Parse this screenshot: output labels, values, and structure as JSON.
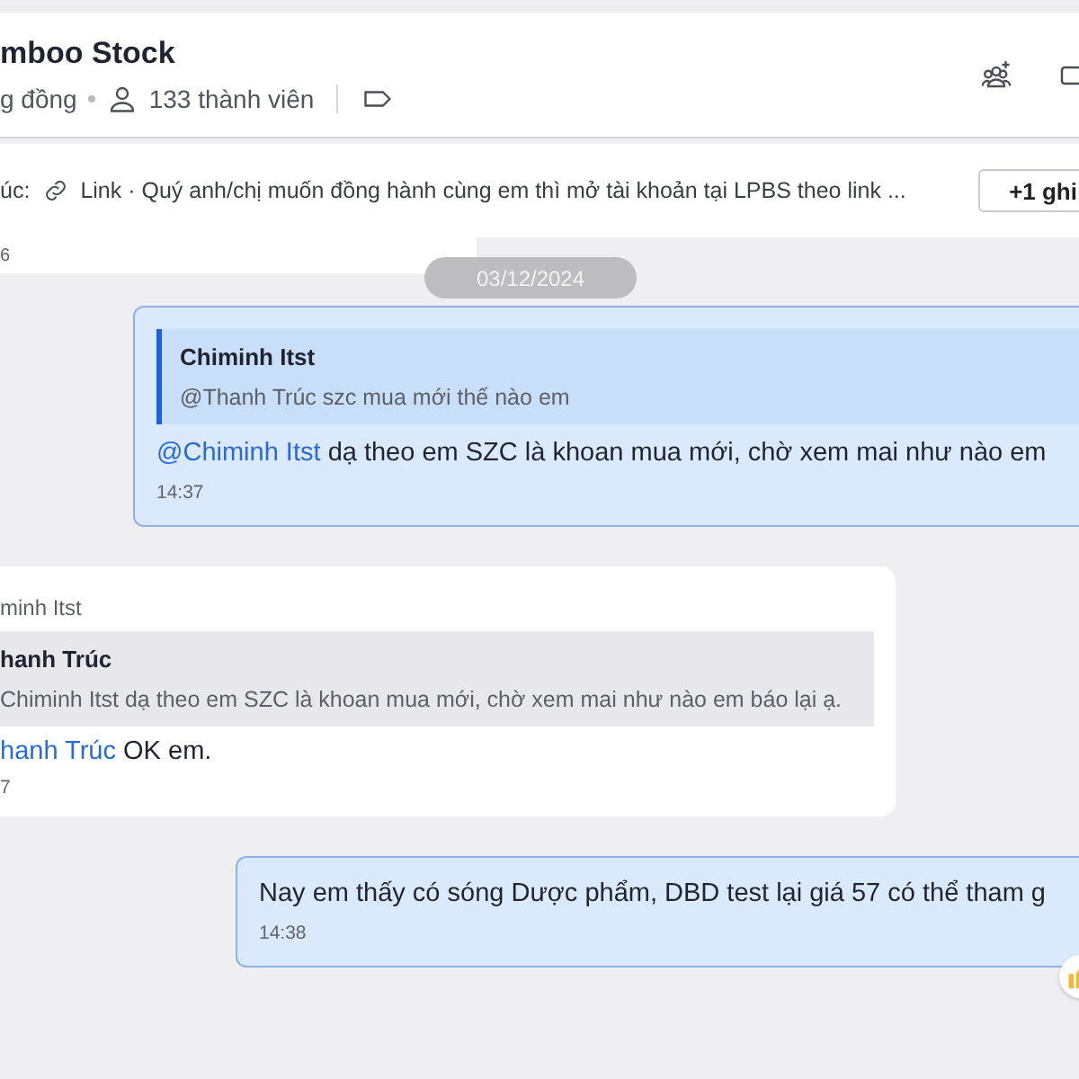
{
  "header": {
    "title": "mboo Stock",
    "community": "g đồng",
    "members": "133 thành viên"
  },
  "pinned": {
    "prefix": "úc:",
    "link_label": "Link",
    "text": "· Quý anh/chị muốn đồng hành cùng em thì mở tài khoản tại LPBS theo link ...",
    "button": "+1 ghi"
  },
  "prev_time": "6",
  "date_separator": "03/12/2024",
  "messages": [
    {
      "kind": "own",
      "quote": {
        "author": "Chiminh Itst",
        "text": "@Thanh Trúc szc mua mới thế nào em"
      },
      "mention": "@Chiminh Itst",
      "text": "dạ theo em SZC là khoan mua mới, chờ xem mai như nào em",
      "time": "14:37"
    },
    {
      "kind": "other",
      "sender": "minh Itst",
      "quote": {
        "author": "hanh Trúc",
        "text": "Chiminh Itst dạ theo em SZC là khoan mua mới, chờ xem mai như nào em báo lại ạ."
      },
      "mention": "hanh Trúc",
      "text": "OK em.",
      "time": "7"
    },
    {
      "kind": "own",
      "text": "Nay em thấy có sóng Dược phẩm, DBD test lại giá 57 có thể tham g",
      "time": "14:38",
      "reaction": true
    }
  ]
}
